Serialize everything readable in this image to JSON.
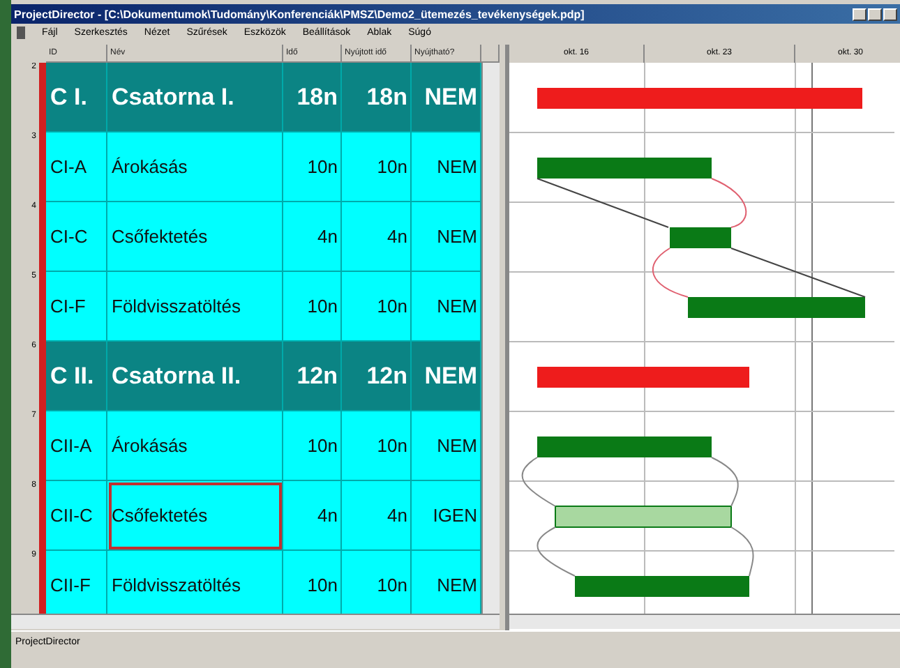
{
  "window": {
    "title": "ProjectDirector - [C:\\Dokumentumok\\Tudomány\\Konferenciák\\PMSZ\\Demo2_ütemezés_tevékenységek.pdp]"
  },
  "menu": [
    "Fájl",
    "Szerkesztés",
    "Nézet",
    "Szűrések",
    "Eszközök",
    "Beállítások",
    "Ablak",
    "Súgó"
  ],
  "table": {
    "columns": [
      "ID",
      "Név",
      "Idő",
      "Nyújtott idő",
      "Nyújtható?"
    ],
    "rows": [
      {
        "number": "2",
        "kind": "summary",
        "selected": false,
        "cells": [
          "C I.",
          "Csatorna I.",
          "18n",
          "18n",
          "NEM"
        ]
      },
      {
        "number": "3",
        "kind": "task",
        "selected": false,
        "cells": [
          "CI-A",
          "Árokásás",
          "10n",
          "10n",
          "NEM"
        ]
      },
      {
        "number": "4",
        "kind": "task",
        "selected": false,
        "cells": [
          "CI-C",
          "Csőfektetés",
          "4n",
          "4n",
          "NEM"
        ]
      },
      {
        "number": "5",
        "kind": "task",
        "selected": false,
        "cells": [
          "CI-F",
          "Földvisszatöltés",
          "10n",
          "10n",
          "NEM"
        ]
      },
      {
        "number": "6",
        "kind": "summary",
        "selected": false,
        "cells": [
          "C II.",
          "Csatorna II.",
          "12n",
          "12n",
          "NEM"
        ]
      },
      {
        "number": "7",
        "kind": "task",
        "selected": false,
        "cells": [
          "CII-A",
          "Árokásás",
          "10n",
          "10n",
          "NEM"
        ]
      },
      {
        "number": "8",
        "kind": "task",
        "selected": true,
        "cells": [
          "CII-C",
          "Csőfektetés",
          "4n",
          "4n",
          "IGEN"
        ]
      },
      {
        "number": "9",
        "kind": "task",
        "selected": false,
        "cells": [
          "CII-F",
          "Földvisszatöltés",
          "10n",
          "10n",
          "NEM"
        ]
      }
    ]
  },
  "gantt": {
    "periods": [
      "okt. 16",
      "okt. 23",
      "okt. 30"
    ]
  },
  "status_bar": {
    "text": "ProjectDirector"
  }
}
